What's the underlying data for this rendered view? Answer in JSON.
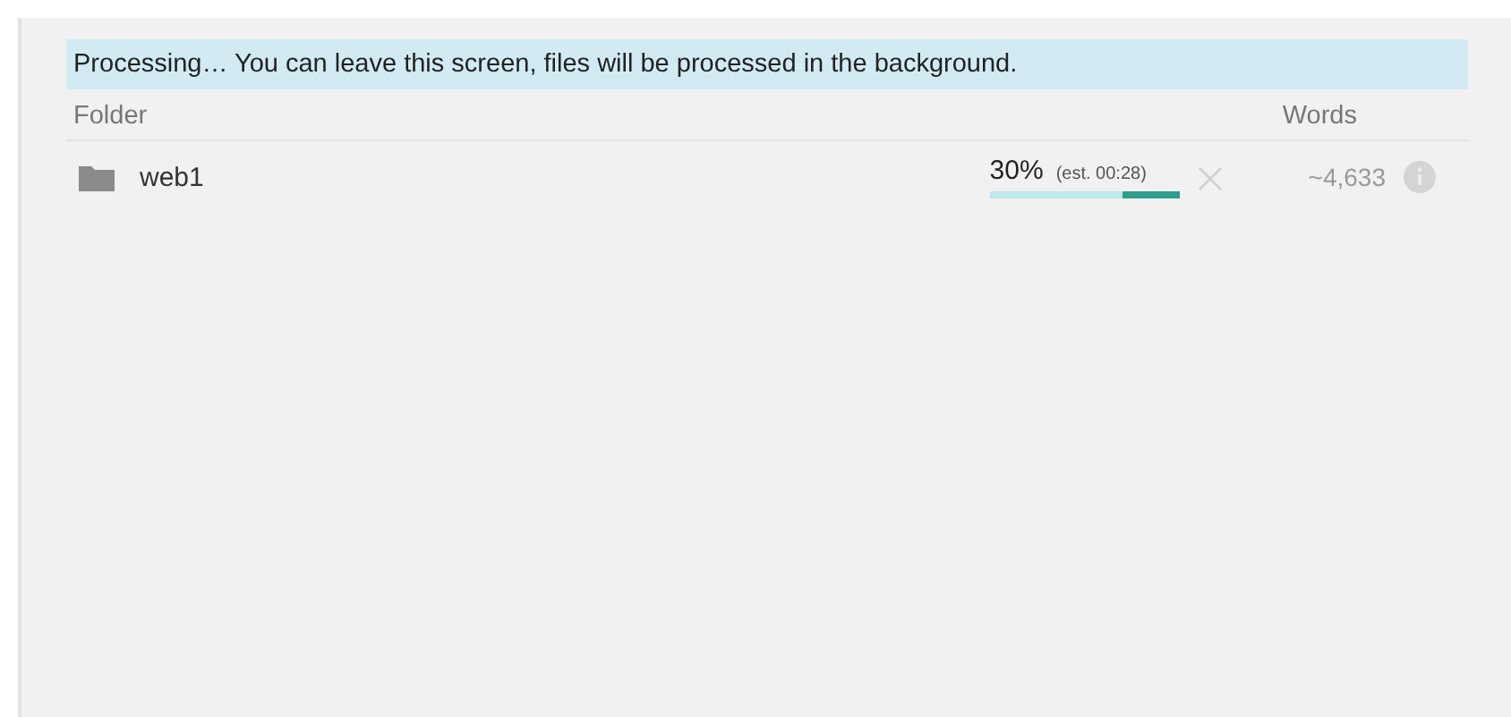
{
  "banner": {
    "text": "Processing… You can leave this screen, files will be processed in the background."
  },
  "table": {
    "columns": [
      "Folder",
      "Words"
    ],
    "rows": [
      {
        "name": "web1",
        "percent": "30%",
        "estimate": "(est. 00:28)",
        "level": 0.3,
        "words": "~4,633"
      }
    ]
  }
}
